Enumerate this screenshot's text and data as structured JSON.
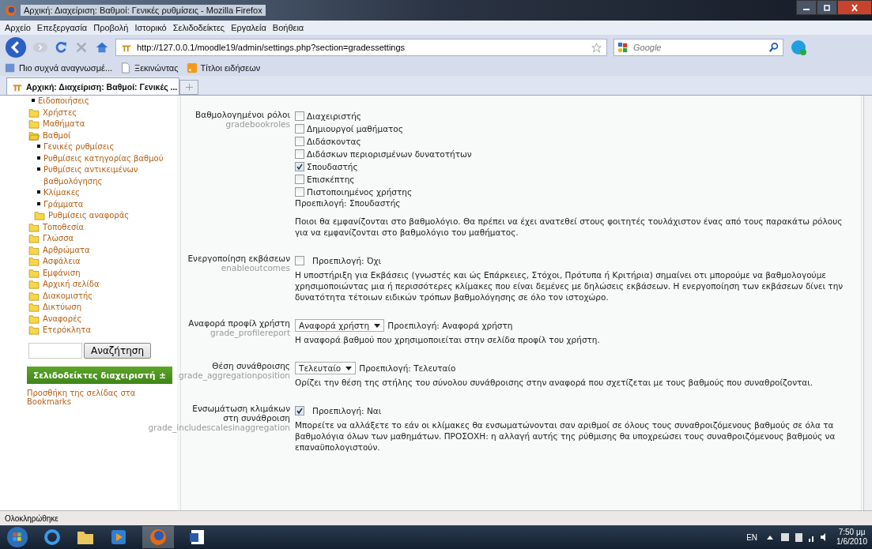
{
  "window": {
    "title": "Αρχική: Διαχείριση: Βαθμοί: Γενικές ρυθμίσεις - Mozilla Firefox"
  },
  "menu": [
    {
      "label": "Αρχείο"
    },
    {
      "label": "Επεξεργασία"
    },
    {
      "label": "Προβολή"
    },
    {
      "label": "Ιστορικό"
    },
    {
      "label": "Σελιδοδείκτες"
    },
    {
      "label": "Εργαλεία"
    },
    {
      "label": "Βοήθεια"
    }
  ],
  "address": {
    "value": "http://127.0.0.1/moodle19/admin/settings.php?section=gradessettings"
  },
  "search": {
    "placeholder": "Google"
  },
  "bookmarks": [
    {
      "label": "Πιο συχνά αναγνωσμέ...",
      "kind": "smart"
    },
    {
      "label": "Ξεκινώντας",
      "kind": "page"
    },
    {
      "label": "Τίτλοι ειδήσεων",
      "kind": "feed"
    }
  ],
  "tabs": [
    {
      "label": "Αρχική: Διαχείριση: Βαθμοί: Γενικές ...",
      "selected": true
    }
  ],
  "sidebar": {
    "items": [
      {
        "label": "Ειδοποιήσεις",
        "kind": "page"
      },
      {
        "label": "Χρήστες",
        "kind": "folder",
        "expanded": false
      },
      {
        "label": "Μαθήματα",
        "kind": "folder",
        "expanded": false
      },
      {
        "label": "Βαθμοί",
        "kind": "folder",
        "expanded": true,
        "children": [
          {
            "label": "Γενικές ρυθμίσεις",
            "kind": "page"
          },
          {
            "label": "Ρυθμίσεις κατηγορίας βαθμού",
            "kind": "page"
          },
          {
            "label": "Ρυθμίσεις αντικειμένων βαθμολόγησης",
            "kind": "page"
          },
          {
            "label": "Κλίμακες",
            "kind": "page"
          },
          {
            "label": "Γράμματα",
            "kind": "page"
          },
          {
            "label": "Ρυθμίσεις αναφοράς",
            "kind": "folder",
            "expanded": false
          }
        ]
      },
      {
        "label": "Τοποθεσία",
        "kind": "folder",
        "expanded": false
      },
      {
        "label": "Γλώσσα",
        "kind": "folder",
        "expanded": false
      },
      {
        "label": "Αρθρώματα",
        "kind": "folder",
        "expanded": false
      },
      {
        "label": "Ασφάλεια",
        "kind": "folder",
        "expanded": false
      },
      {
        "label": "Εμφάνιση",
        "kind": "folder",
        "expanded": false
      },
      {
        "label": "Αρχική σελίδα",
        "kind": "folder",
        "expanded": false
      },
      {
        "label": "Διακομιστής",
        "kind": "folder",
        "expanded": false
      },
      {
        "label": "Δικτύωση",
        "kind": "folder",
        "expanded": false
      },
      {
        "label": "Αναφορές",
        "kind": "folder",
        "expanded": false
      },
      {
        "label": "Ετερόκλητα",
        "kind": "folder",
        "expanded": false
      }
    ],
    "search_button": "Αναζήτηση",
    "block": {
      "title": "Σελιδοδείκτες διαχειριστή",
      "toggle": "±",
      "link": "Προσθήκη της σελίδας στα Bookmarks"
    }
  },
  "settings": [
    {
      "kind": "checklist",
      "label": "Βαθμολογημένοι ρόλοι",
      "name": "gradebookroles",
      "options": [
        {
          "label": "Διαχειριστής",
          "checked": false
        },
        {
          "label": "Δημιουργοί μαθήματος",
          "checked": false
        },
        {
          "label": "Διδάσκοντας",
          "checked": false
        },
        {
          "label": "Διδάσκων περιορισμένων δυνατοτήτων",
          "checked": false
        },
        {
          "label": "Σπουδαστής",
          "checked": true
        },
        {
          "label": "Επισκέπτης",
          "checked": false
        },
        {
          "label": "Πιστοποιημένος χρήστης",
          "checked": false
        }
      ],
      "default": "Προεπιλογή: Σπουδαστής",
      "description": "Ποιοι θα εμφανίζονται στο βαθμολόγιο. Θα πρέπει να έχει ανατεθεί στους φοιτητές τουλάχιστον ένας από τους παρακάτω ρόλους για να εμφανίζονται στο βαθμολόγιο του μαθήματος."
    },
    {
      "kind": "checkbox",
      "label": "Ενεργοποίηση εκβάσεων",
      "name": "enableoutcomes",
      "checked": false,
      "default": "Προεπιλογή: Όχι",
      "description": "Η υποστήριξη για Εκβάσεις (γνωστές και ώς Επάρκειες, Στόχοι, Πρότυπα ή Κριτήρια) σημαίνει οτι μπορούμε να βαθμολογούμε χρησιμοποιώντας μια ή περισσότερες κλίμακες που είναι δεμένες με δηλώσεις εκβάσεων. Η ενεργοποίηση των εκβάσεων δίνει την δυνατότητα τέτοιων ειδικών τρόπων βαθμολόγησης σε όλο τον ιστοχώρο."
    },
    {
      "kind": "select",
      "label": "Αναφορά προφίλ χρήστη",
      "name": "grade_profilereport",
      "value": "Αναφορά χρήστη",
      "default": "Προεπιλογή: Αναφορά χρήστη",
      "description": "Η αναφορά βαθμού που χρησιμοποιείται στην σελίδα προφίλ του χρήστη."
    },
    {
      "kind": "select",
      "label": "Θέση συνάθροισης",
      "name": "grade_aggregationposition",
      "value": "Τελευταίο",
      "default": "Προεπιλογή: Τελευταίο",
      "description": "Ορίζει την θέση της στήλης του σύνολου συνάθροισης στην αναφορά που σχετίζεται με τους βαθμούς που συναθροίζονται."
    },
    {
      "kind": "checkbox",
      "label": "Ενσωμάτωση κλιμάκων στη συνάθροιση",
      "name": "grade_includescalesinaggregation",
      "checked": true,
      "default": "Προεπιλογή: Ναι",
      "description": "Μπορείτε να αλλάξετε το εάν οι κλίμακες θα ενσωματώνονται σαν αριθμοί σε όλους τους συναθροιζόμενους βαθμούς σε όλα τα βαθμολόγια όλων των μαθημάτων. ΠΡΟΣΟΧΗ: η αλλαγή αυτής της ρύθμισης θα υποχρεώσει τους συναθροιζόμενους βαθμούς να επαναϋπολογιστούν."
    }
  ],
  "status_bar": "Ολοκληρώθηκε",
  "taskbar": {
    "language": "EN",
    "time": "7:50 μμ",
    "date": "1/6/2010"
  }
}
